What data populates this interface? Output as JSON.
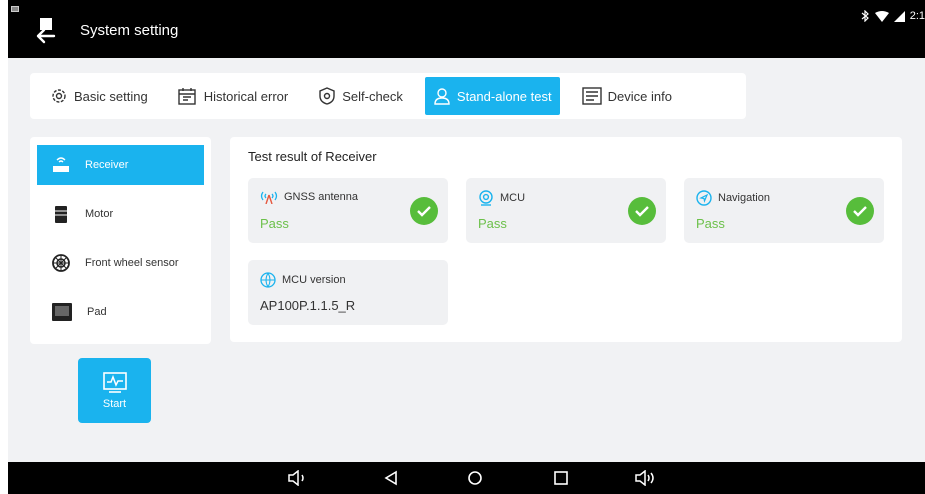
{
  "header": {
    "title": "System setting"
  },
  "status": {
    "time": "2:1"
  },
  "tabs": [
    {
      "label": "Basic setting",
      "icon": "gear-icon"
    },
    {
      "label": "Historical error",
      "icon": "calendar-icon"
    },
    {
      "label": "Self-check",
      "icon": "shield-icon"
    },
    {
      "label": "Stand-alone test",
      "icon": "person-icon",
      "active": true
    },
    {
      "label": "Device info",
      "icon": "document-icon"
    }
  ],
  "sidebar": {
    "items": [
      {
        "label": "Receiver",
        "icon": "receiver-icon",
        "active": true
      },
      {
        "label": "Motor",
        "icon": "motor-icon"
      },
      {
        "label": "Front wheel sensor",
        "icon": "wheel-sensor-icon"
      },
      {
        "label": "Pad",
        "icon": "pad-icon"
      }
    ]
  },
  "start_button": {
    "label": "Start",
    "icon": "monitor-pulse-icon"
  },
  "result": {
    "title": "Test result of Receiver",
    "cards": [
      {
        "label": "GNSS antenna",
        "value": "Pass",
        "icon": "antenna-icon",
        "status": "pass"
      },
      {
        "label": "MCU",
        "value": "Pass",
        "icon": "mcu-icon",
        "status": "pass"
      },
      {
        "label": "Navigation",
        "value": "Pass",
        "icon": "navigation-icon",
        "status": "pass"
      },
      {
        "label": "MCU version",
        "value": "AP100P.1.1.5_R",
        "icon": "globe-icon"
      }
    ]
  },
  "colors": {
    "accent": "#1ab3ee",
    "pass_text": "#6cc04a",
    "check_bg": "#57bd3b",
    "bar": "#000000",
    "panel_bg": "#f1f2f4"
  }
}
